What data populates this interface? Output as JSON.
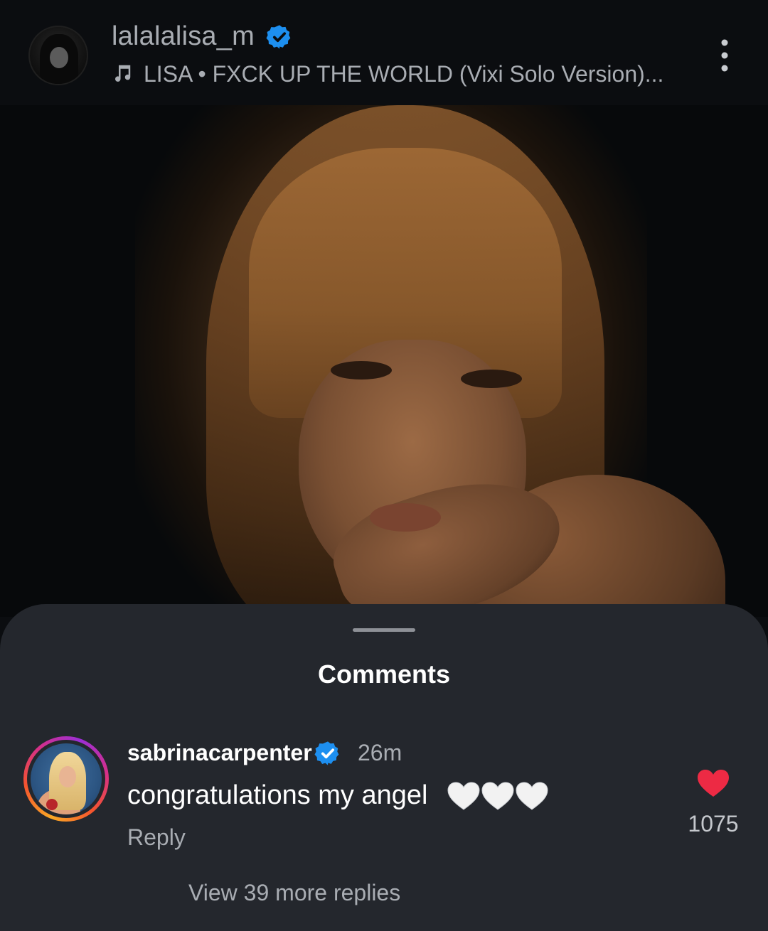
{
  "post": {
    "username": "lalalalisa_m",
    "verified": true,
    "music_label": "LISA • FXCK UP THE WORLD (Vixi Solo Version)...",
    "icons": {
      "music": "music-note-icon",
      "more": "more-vertical-icon",
      "verified": "verified-badge-icon"
    }
  },
  "comments_sheet": {
    "title": "Comments",
    "comment": {
      "username": "sabrinacarpenter",
      "verified": true,
      "time": "26m",
      "text": "congratulations my angel",
      "emoji": "🤍🤍🤍",
      "reply_label": "Reply",
      "like_count": "1075",
      "liked": true,
      "like_color": "#ed2a44"
    },
    "view_replies_label": "View 39 more replies"
  },
  "colors": {
    "background": "#0b0d10",
    "sheet": "#24272d",
    "muted_text": "#a9adb3",
    "verified_blue": "#1d8ff0"
  }
}
